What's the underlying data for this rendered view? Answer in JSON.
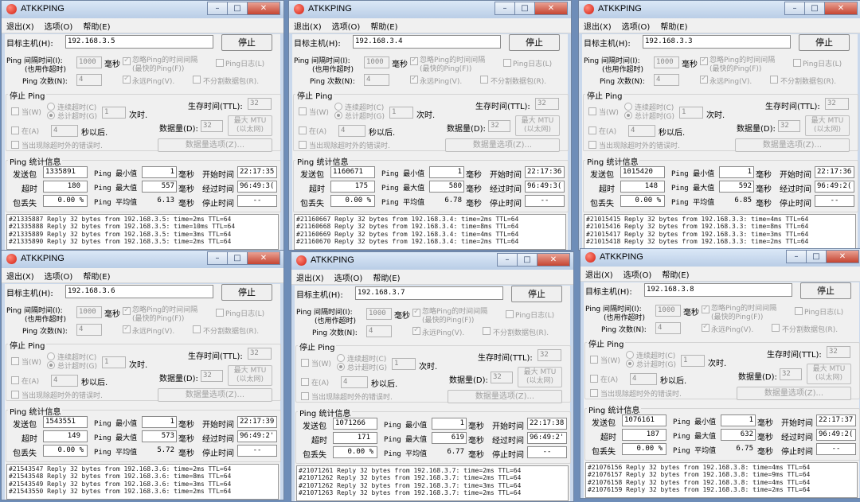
{
  "ui": {
    "title": "ATKKPING",
    "window_buttons": [
      "–",
      "□",
      "✕"
    ],
    "menu": [
      "退出(X)",
      "选项(O)",
      "帮助(E)"
    ],
    "target_label": "目标主机(H):",
    "stop_label": "停止",
    "interval_label_1": "Ping 间隔时间(I):",
    "interval_label_2": "(也用作超时)",
    "interval_value": "1000",
    "ms_label": "毫秒",
    "ignore_label_1": "忽略Ping的时间间隔",
    "ignore_label_2": "(最快的Ping(F))",
    "ping_log_label": "Ping日志(L)",
    "count_label": "Ping 次数(N):",
    "count_value": "4",
    "forever_label": "永远Ping(V).",
    "no_frag_label": "不分割数据包(R).",
    "stop_ping_label": "停止 Ping",
    "when_label": "当(W)",
    "consec_timeout_label": "连续超时(C)",
    "total_timeout_label": "总计超时(G)",
    "times_value": "1",
    "times_label": "次时.",
    "ttl_label": "生存时间(TTL):",
    "ttl_value": "32",
    "at_label": "在(A)",
    "at_value": "4",
    "sec_after_label": "秒以后.",
    "data_size_label": "数据量(D):",
    "data_size_value": "32",
    "max_mtu_label_1": "最大 MTU",
    "max_mtu_label_2": "(以太网)",
    "error_label": "当出现除超时外的错误时.",
    "data_options_label": "数据量选项(Z)...",
    "stats_label": "Ping 统计信息",
    "sent_label": "发送包",
    "timeout_label": "超时",
    "loss_label": "包丢失",
    "min_label": "Ping 最小值",
    "max_label": "Ping 最大值",
    "avg_label": "Ping 平均值",
    "unit_ms": "毫秒",
    "start_time_label": "开始时间",
    "elapsed_label": "经过时间",
    "stop_time_label": "停止时间",
    "stop_time_value": "--"
  },
  "windows": [
    {
      "target": "192.168.3.5",
      "sent": "1335891",
      "timeouts": "180",
      "loss": "0.00 %",
      "min": "1",
      "max": "557",
      "avg": "6.13",
      "start": "22:17:35",
      "elapsed": "96:49:3(",
      "log": [
        "#21335887 Reply 32 bytes from 192.168.3.5: time=2ms TTL=64",
        "#21335888 Reply 32 bytes from 192.168.3.5: time=10ms TTL=64",
        "#21335889 Reply 32 bytes from 192.168.3.5: time=3ms TTL=64",
        "#21335890 Reply 32 bytes from 192.168.3.5: time=2ms TTL=64"
      ]
    },
    {
      "target": "192.168.3.4",
      "sent": "1160671",
      "timeouts": "175",
      "loss": "0.00 %",
      "min": "1",
      "max": "580",
      "avg": "6.78",
      "start": "22:17:36",
      "elapsed": "96:49:3(",
      "log": [
        "#21160667 Reply 32 bytes from 192.168.3.4: time=2ms TTL=64",
        "#21160668 Reply 32 bytes from 192.168.3.4: time=8ms TTL=64",
        "#21160669 Reply 32 bytes from 192.168.3.4: time=4ms TTL=64",
        "#21160670 Reply 32 bytes from 192.168.3.4: time=2ms TTL=64"
      ]
    },
    {
      "target": "192.168.3.3",
      "sent": "1015420",
      "timeouts": "148",
      "loss": "0.00 %",
      "min": "1",
      "max": "592",
      "avg": "6.85",
      "start": "22:17:36",
      "elapsed": "96:49:2(",
      "log": [
        "#21015415 Reply 32 bytes from 192.168.3.3: time=4ms TTL=64",
        "#21015416 Reply 32 bytes from 192.168.3.3: time=8ms TTL=64",
        "#21015417 Reply 32 bytes from 192.168.3.3: time=3ms TTL=64",
        "#21015418 Reply 32 bytes from 192.168.3.3: time=2ms TTL=64"
      ]
    },
    {
      "target": "192.168.3.6",
      "sent": "1543551",
      "timeouts": "149",
      "loss": "0.00 %",
      "min": "1",
      "max": "573",
      "avg": "5.72",
      "start": "22:17:39",
      "elapsed": "96:49:2'",
      "log": [
        "#21543547 Reply 32 bytes from 192.168.3.6: time=2ms TTL=64",
        "#21543548 Reply 32 bytes from 192.168.3.6: time=8ms TTL=64",
        "#21543549 Reply 32 bytes from 192.168.3.6: time=3ms TTL=64",
        "#21543550 Reply 32 bytes from 192.168.3.6: time=2ms TTL=64"
      ]
    },
    {
      "target": "192.168.3.7",
      "sent": "1071266",
      "timeouts": "171",
      "loss": "0.00 %",
      "min": "1",
      "max": "619",
      "avg": "6.77",
      "start": "22:17:38",
      "elapsed": "96:49:2'",
      "log": [
        "#21071261 Reply 32 bytes from 192.168.3.7: time=2ms TTL=64",
        "#21071262 Reply 32 bytes from 192.168.3.7: time=2ms TTL=64",
        "#21071262 Reply 32 bytes from 192.168.3.7: time=3ms TTL=64",
        "#21071263 Reply 32 bytes from 192.168.3.7: time=2ms TTL=64"
      ]
    },
    {
      "target": "192.168.3.8",
      "sent": "1076161",
      "timeouts": "187",
      "loss": "0.00 %",
      "min": "1",
      "max": "632",
      "avg": "6.75",
      "start": "22:17:37",
      "elapsed": "96:49:2(",
      "log": [
        "#21076156 Reply 32 bytes from 192.168.3.8: time=4ms TTL=64",
        "#21076157 Reply 32 bytes from 192.168.3.8: time=9ms TTL=64",
        "#21076158 Reply 32 bytes from 192.168.3.8: time=4ms TTL=64",
        "#21076159 Reply 32 bytes from 192.168.3.8: time=2ms TTL=64"
      ]
    }
  ]
}
